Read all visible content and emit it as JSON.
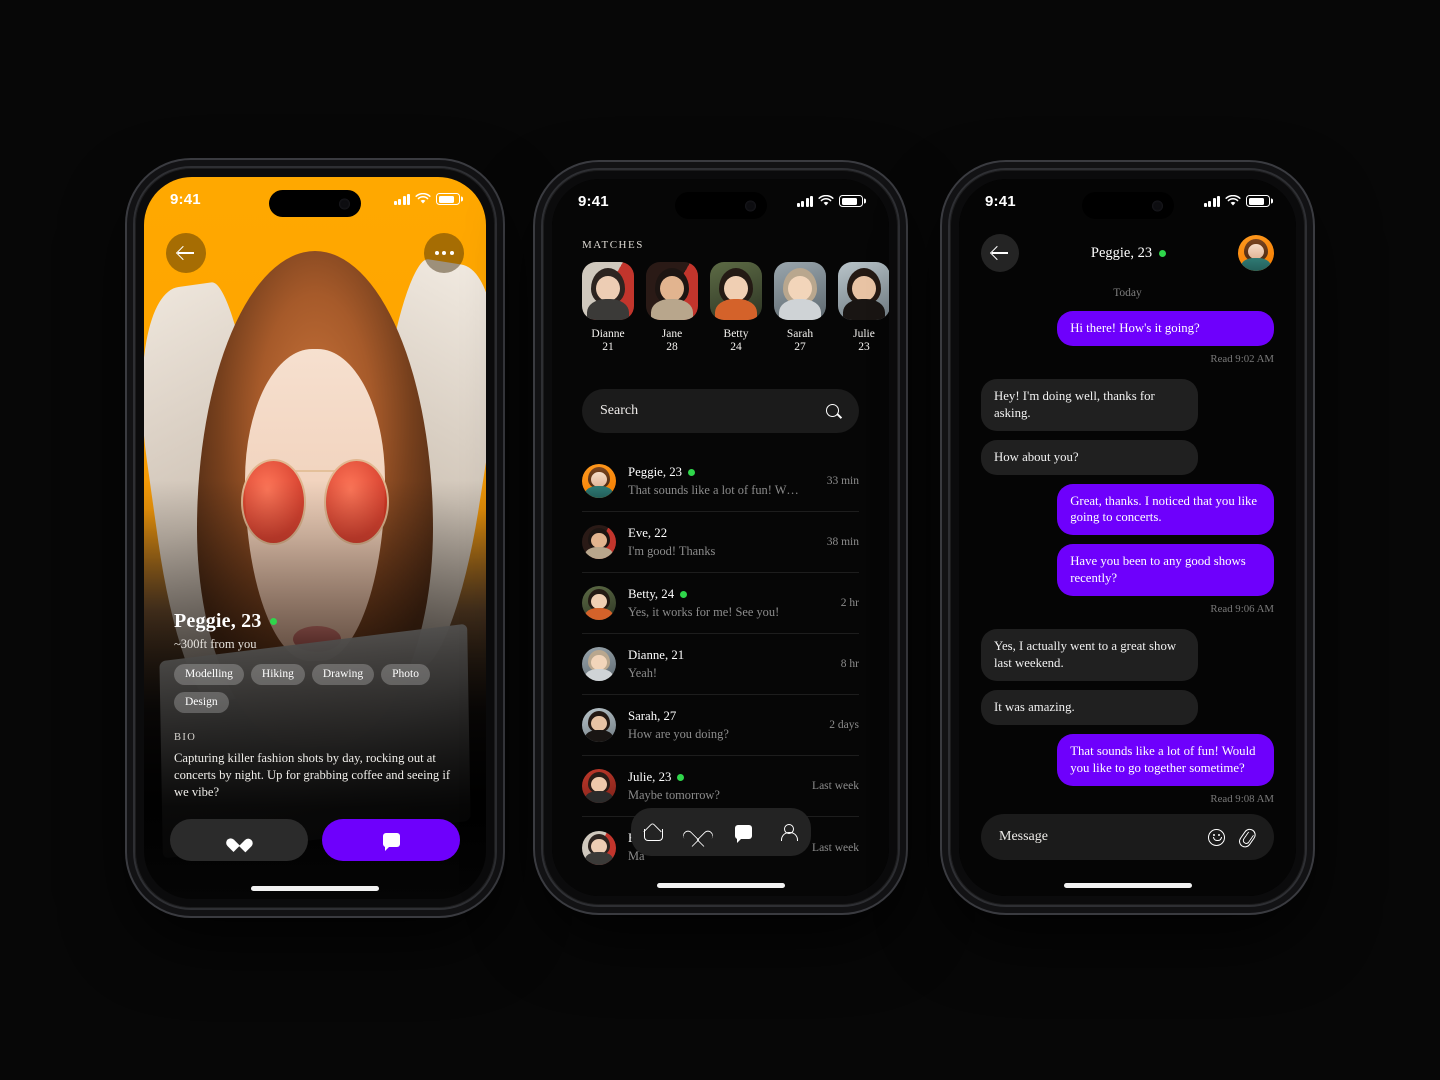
{
  "accent": "#6E00FC",
  "online_color": "#2FD64B",
  "orange": "#FFA800",
  "status_bar": {
    "time": "9:41",
    "signal_icon": "cellular-bars-icon",
    "wifi_icon": "wifi-icon",
    "battery_icon": "battery-icon"
  },
  "profile_screen": {
    "back_icon": "back-arrow-icon",
    "more_icon": "more-options-icon",
    "name": "Peggie, 23",
    "distance": "~300ft from you",
    "tags": [
      "Modelling",
      "Hiking",
      "Drawing",
      "Photo",
      "Design"
    ],
    "bio_label": "BIO",
    "bio_text": "Capturing killer fashion shots by day, rocking out at concerts by night. Up for grabbing coffee and seeing if we vibe?",
    "like_icon": "heart-icon",
    "chat_icon": "chat-bubble-icon"
  },
  "list_screen": {
    "section_title": "MATCHES",
    "matches": [
      {
        "name": "Dianne",
        "age": "21"
      },
      {
        "name": "Jane",
        "age": "28"
      },
      {
        "name": "Betty",
        "age": "24"
      },
      {
        "name": "Sarah",
        "age": "27"
      },
      {
        "name": "Julie",
        "age": "23"
      }
    ],
    "search": {
      "placeholder": "Search",
      "icon": "search-icon"
    },
    "chats": [
      {
        "name": "Peggie, 23",
        "preview": "That sounds like a lot of fun! W…",
        "time": "33 min",
        "online": true
      },
      {
        "name": "Eve, 22",
        "preview": "I'm good! Thanks",
        "time": "38 min",
        "online": false
      },
      {
        "name": "Betty, 24",
        "preview": "Yes, it works for me! See you!",
        "time": "2 hr",
        "online": true
      },
      {
        "name": "Dianne, 21",
        "preview": "Yeah!",
        "time": "8 hr",
        "online": false
      },
      {
        "name": "Sarah, 27",
        "preview": "How are you doing?",
        "time": "2 days",
        "online": false
      },
      {
        "name": "Julie, 23",
        "preview": "Maybe tomorrow?",
        "time": "Last week",
        "online": true
      },
      {
        "name": "F",
        "preview": "Ma",
        "time": "Last week",
        "online": false
      }
    ],
    "tabs": [
      {
        "icon": "home-icon",
        "label": "Home"
      },
      {
        "icon": "heart-icon",
        "label": "Likes"
      },
      {
        "icon": "chat-icon",
        "label": "Chats"
      },
      {
        "icon": "profile-icon",
        "label": "Profile"
      }
    ]
  },
  "chat_screen": {
    "back_icon": "back-arrow-icon",
    "title": "Peggie, 23",
    "avatar_icon": "contact-avatar",
    "day_separator": "Today",
    "messages": [
      {
        "side": "out",
        "text": "Hi there! How's it going?"
      },
      {
        "side": "read",
        "text": "Read 9:02 AM"
      },
      {
        "side": "in",
        "text": "Hey! I'm doing well, thanks for asking."
      },
      {
        "side": "in",
        "text": "How about you?"
      },
      {
        "side": "out",
        "text": "Great, thanks. I noticed that you like going to concerts."
      },
      {
        "side": "out",
        "text": "Have you been to any good shows recently?"
      },
      {
        "side": "read",
        "text": "Read 9:06 AM"
      },
      {
        "side": "in",
        "text": "Yes, I actually went to a great show last weekend."
      },
      {
        "side": "in",
        "text": "It was amazing."
      },
      {
        "side": "out",
        "text": "That sounds like a lot of fun! Would you like to go together sometime?"
      },
      {
        "side": "read",
        "text": "Read 9:08 AM"
      }
    ],
    "composer": {
      "placeholder": "Message",
      "emoji_icon": "smiley-icon",
      "attach_icon": "paperclip-icon"
    }
  }
}
